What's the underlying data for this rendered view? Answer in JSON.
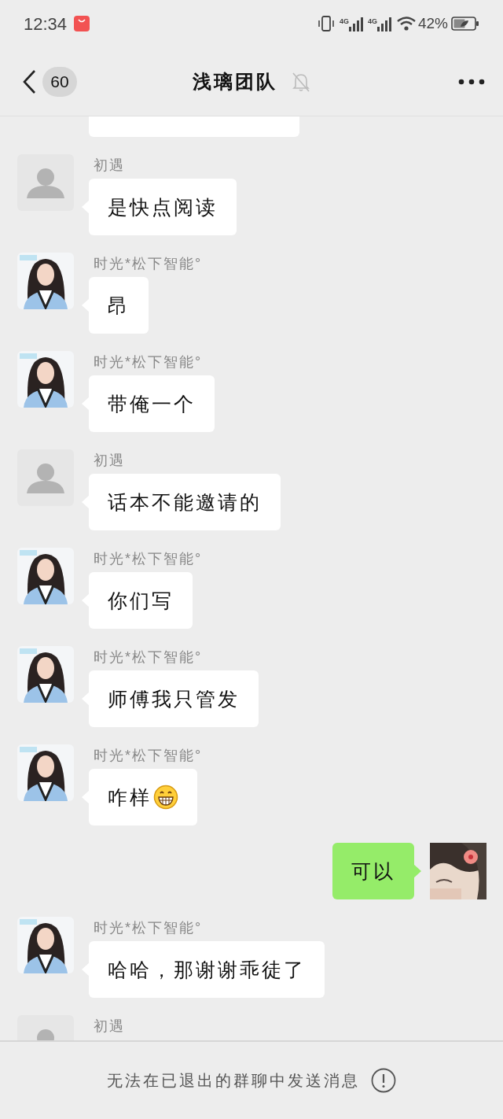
{
  "status_bar": {
    "time": "12:34",
    "network_1": "4G",
    "network_2": "4G",
    "battery": "42%"
  },
  "header": {
    "unread_count": "60",
    "title": "浅璃团队",
    "muted": true
  },
  "messages": [
    {
      "kind": "incoming",
      "cut_at_top": true
    },
    {
      "kind": "incoming",
      "avatar": {
        "kind": "default"
      },
      "sender": "初遇",
      "text": "是快点阅读"
    },
    {
      "kind": "incoming",
      "sender": "时光*松下智能°",
      "text": "昂"
    },
    {
      "kind": "incoming",
      "sender": "时光*松下智能°",
      "text": "带俺一个"
    },
    {
      "kind": "incoming",
      "avatar": {
        "kind": "default"
      },
      "sender": "初遇",
      "text": "话本不能邀请的"
    },
    {
      "kind": "incoming",
      "sender": "时光*松下智能°",
      "text": "你们写"
    },
    {
      "kind": "incoming",
      "sender": "时光*松下智能°",
      "text": "师傅我只管发"
    },
    {
      "kind": "incoming",
      "sender": "时光*松下智能°",
      "text": "咋样",
      "grin_emoji": true
    },
    {
      "kind": "outgoing",
      "text": "可以"
    },
    {
      "kind": "incoming",
      "sender": "时光*松下智能°",
      "text": "哈哈，那谢谢乖徒了"
    },
    {
      "kind": "incoming",
      "avatar": {
        "kind": "default"
      },
      "sender": "初遇"
    }
  ],
  "footer": {
    "notice": "无法在已退出的群聊中发送消息"
  }
}
